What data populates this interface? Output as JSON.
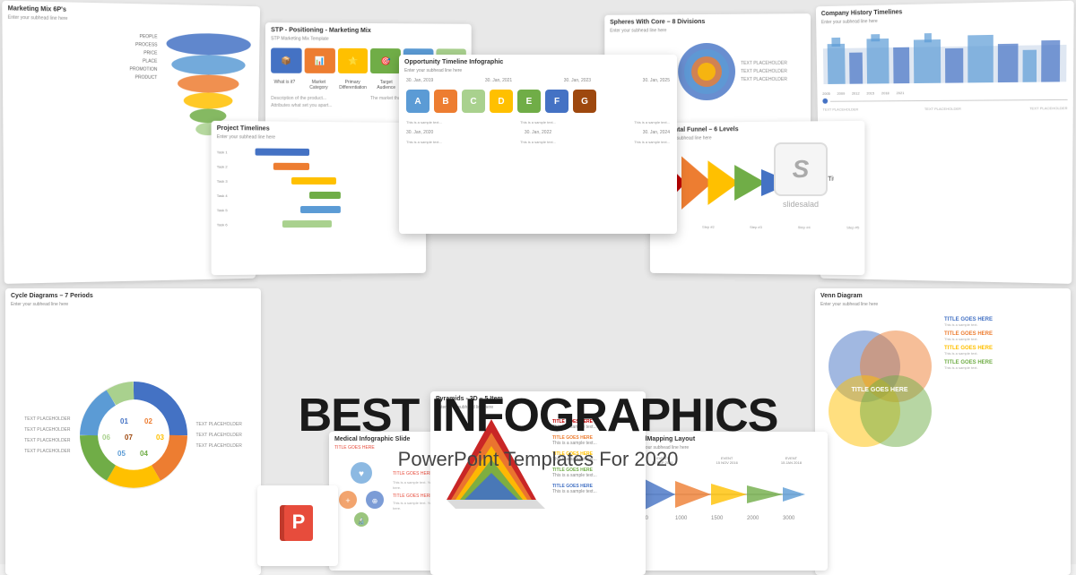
{
  "page": {
    "background_color": "#e0e0e0",
    "main_title": "BEST INFOGRAPHICS",
    "main_subtitle": "PowerPoint Templates For 2020"
  },
  "cards": {
    "marketing_mix": {
      "title": "Marketing Mix 6P's",
      "subtitle": "Enter your subhead line here"
    },
    "stp": {
      "title": "STP - Positioning - Marketing Mix",
      "subtitle": "STP Marketing Mix Template"
    },
    "spheres": {
      "title": "Spheres With Core – 8 Divisions",
      "subtitle": "Enter your subhead line here"
    },
    "opportunity": {
      "title": "Opportunity Timeline Infographic",
      "subtitle": "Enter your subhead line here"
    },
    "project_timelines": {
      "title": "Project Timelines",
      "subtitle": "Enter your subhead line here"
    },
    "horizontal_funnel": {
      "title": "Horizontal Funnel – 6 Levels",
      "subtitle": "Enter your subhead line here"
    },
    "company_history": {
      "title": "Company History Timelines",
      "subtitle": "Enter your subhead line here"
    },
    "cycle_diagrams": {
      "title": "Cycle Diagrams – 7 Periods",
      "subtitle": "Enter your subhead line here"
    },
    "venn_diagram": {
      "title": "Venn Diagram",
      "subtitle": "Enter your subhead line here"
    },
    "medical": {
      "title": "Medical Infographic Slide",
      "subtitle": "TITLE GOES HERE"
    },
    "pyramids": {
      "title": "Pyramids - 3D – 5 Item",
      "subtitle": "Enter your subhead line here"
    },
    "roadmapping": {
      "title": "RoadMapping Layout",
      "subtitle": "Enter your subhead line here"
    }
  },
  "opp_letters": [
    "A",
    "B",
    "C",
    "D",
    "E",
    "F",
    "G"
  ],
  "opp_colors": [
    "#5b9bd5",
    "#ed7d31",
    "#a9d18e",
    "#ffc000",
    "#70ad47",
    "#4472c4",
    "#9e480e"
  ],
  "stp_colors": [
    "#4472c4",
    "#ed7d31",
    "#ffc000",
    "#70ad47",
    "#5b9bd5",
    "#a9d18e"
  ],
  "gantt_colors": [
    "#4472c4",
    "#ed7d31",
    "#a9d18e",
    "#ffc000",
    "#5b9bd5",
    "#70ad47"
  ],
  "cycle_colors": [
    "#4472c4",
    "#ed7d31",
    "#ffc000",
    "#70ad47",
    "#5b9bd5",
    "#a9d18e",
    "#9e480e"
  ],
  "funnel_colors": [
    "#c00000",
    "#ed7d31",
    "#ffc000",
    "#70ad47",
    "#4472c4",
    "#5b9bd5"
  ],
  "slidesalad": {
    "letter": "S",
    "name": "slidesalad",
    "color": "#aaa"
  }
}
